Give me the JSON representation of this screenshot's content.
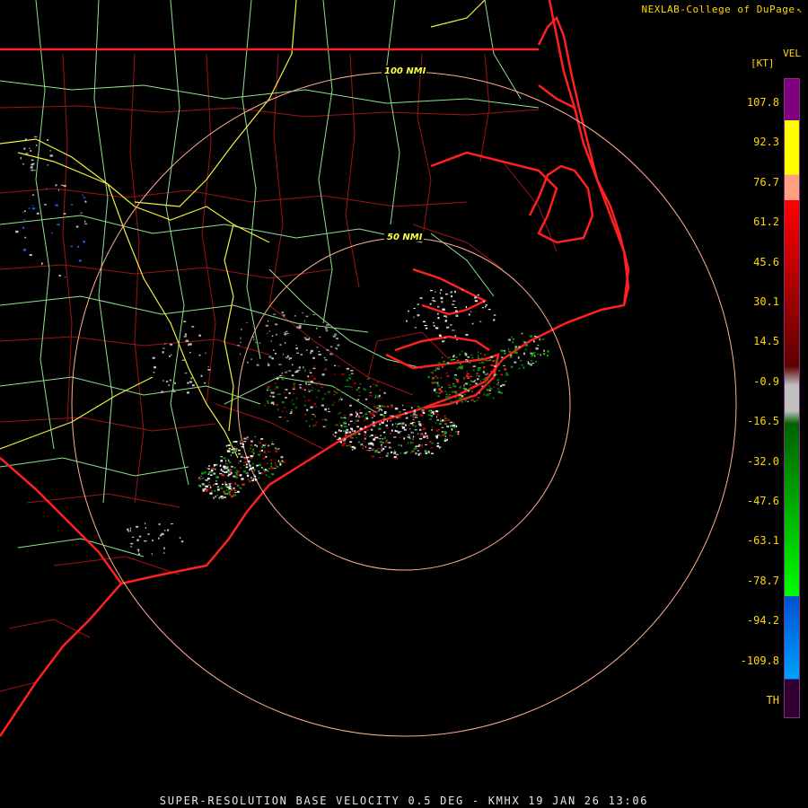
{
  "header": {
    "credit": "NEXLAB-College of DuPage",
    "credit_icon": "arrow-cursor-icon"
  },
  "map": {
    "ring_labels": [
      "100 NMI",
      "50 NMI"
    ],
    "colors": {
      "background": "#000000",
      "state_border": "#ff2020",
      "county_border": "#b01818",
      "highway_primary": "#f0f040",
      "highway_secondary": "#90e090",
      "range_ring": "#ffb090",
      "ring_label": "#ffff40"
    }
  },
  "legend": {
    "title_top": "VEL",
    "title_unit": "[KT]",
    "labels": [
      "107.8",
      "92.3",
      "76.7",
      "61.2",
      "45.6",
      "30.1",
      "14.5",
      "-0.9",
      "-16.5",
      "-32.0",
      "-47.6",
      "-63.1",
      "-78.7",
      "-94.2",
      "-109.8",
      "TH"
    ],
    "colors": {
      "purple": "#800080",
      "yellow": "#ffff00",
      "peach": "#ffa080",
      "red": "#ff0000",
      "dark_red": "#600000",
      "gray": "#c0c0c0",
      "dark_green": "#006000",
      "green": "#00ff00",
      "blue": "#0050d0",
      "light_blue": "#00a0ff",
      "range_folded": "#300030"
    }
  },
  "footer": {
    "product": "SUPER-RESOLUTION BASE VELOCITY 0.5 DEG - KMHX 19 JAN 26 13:06"
  }
}
